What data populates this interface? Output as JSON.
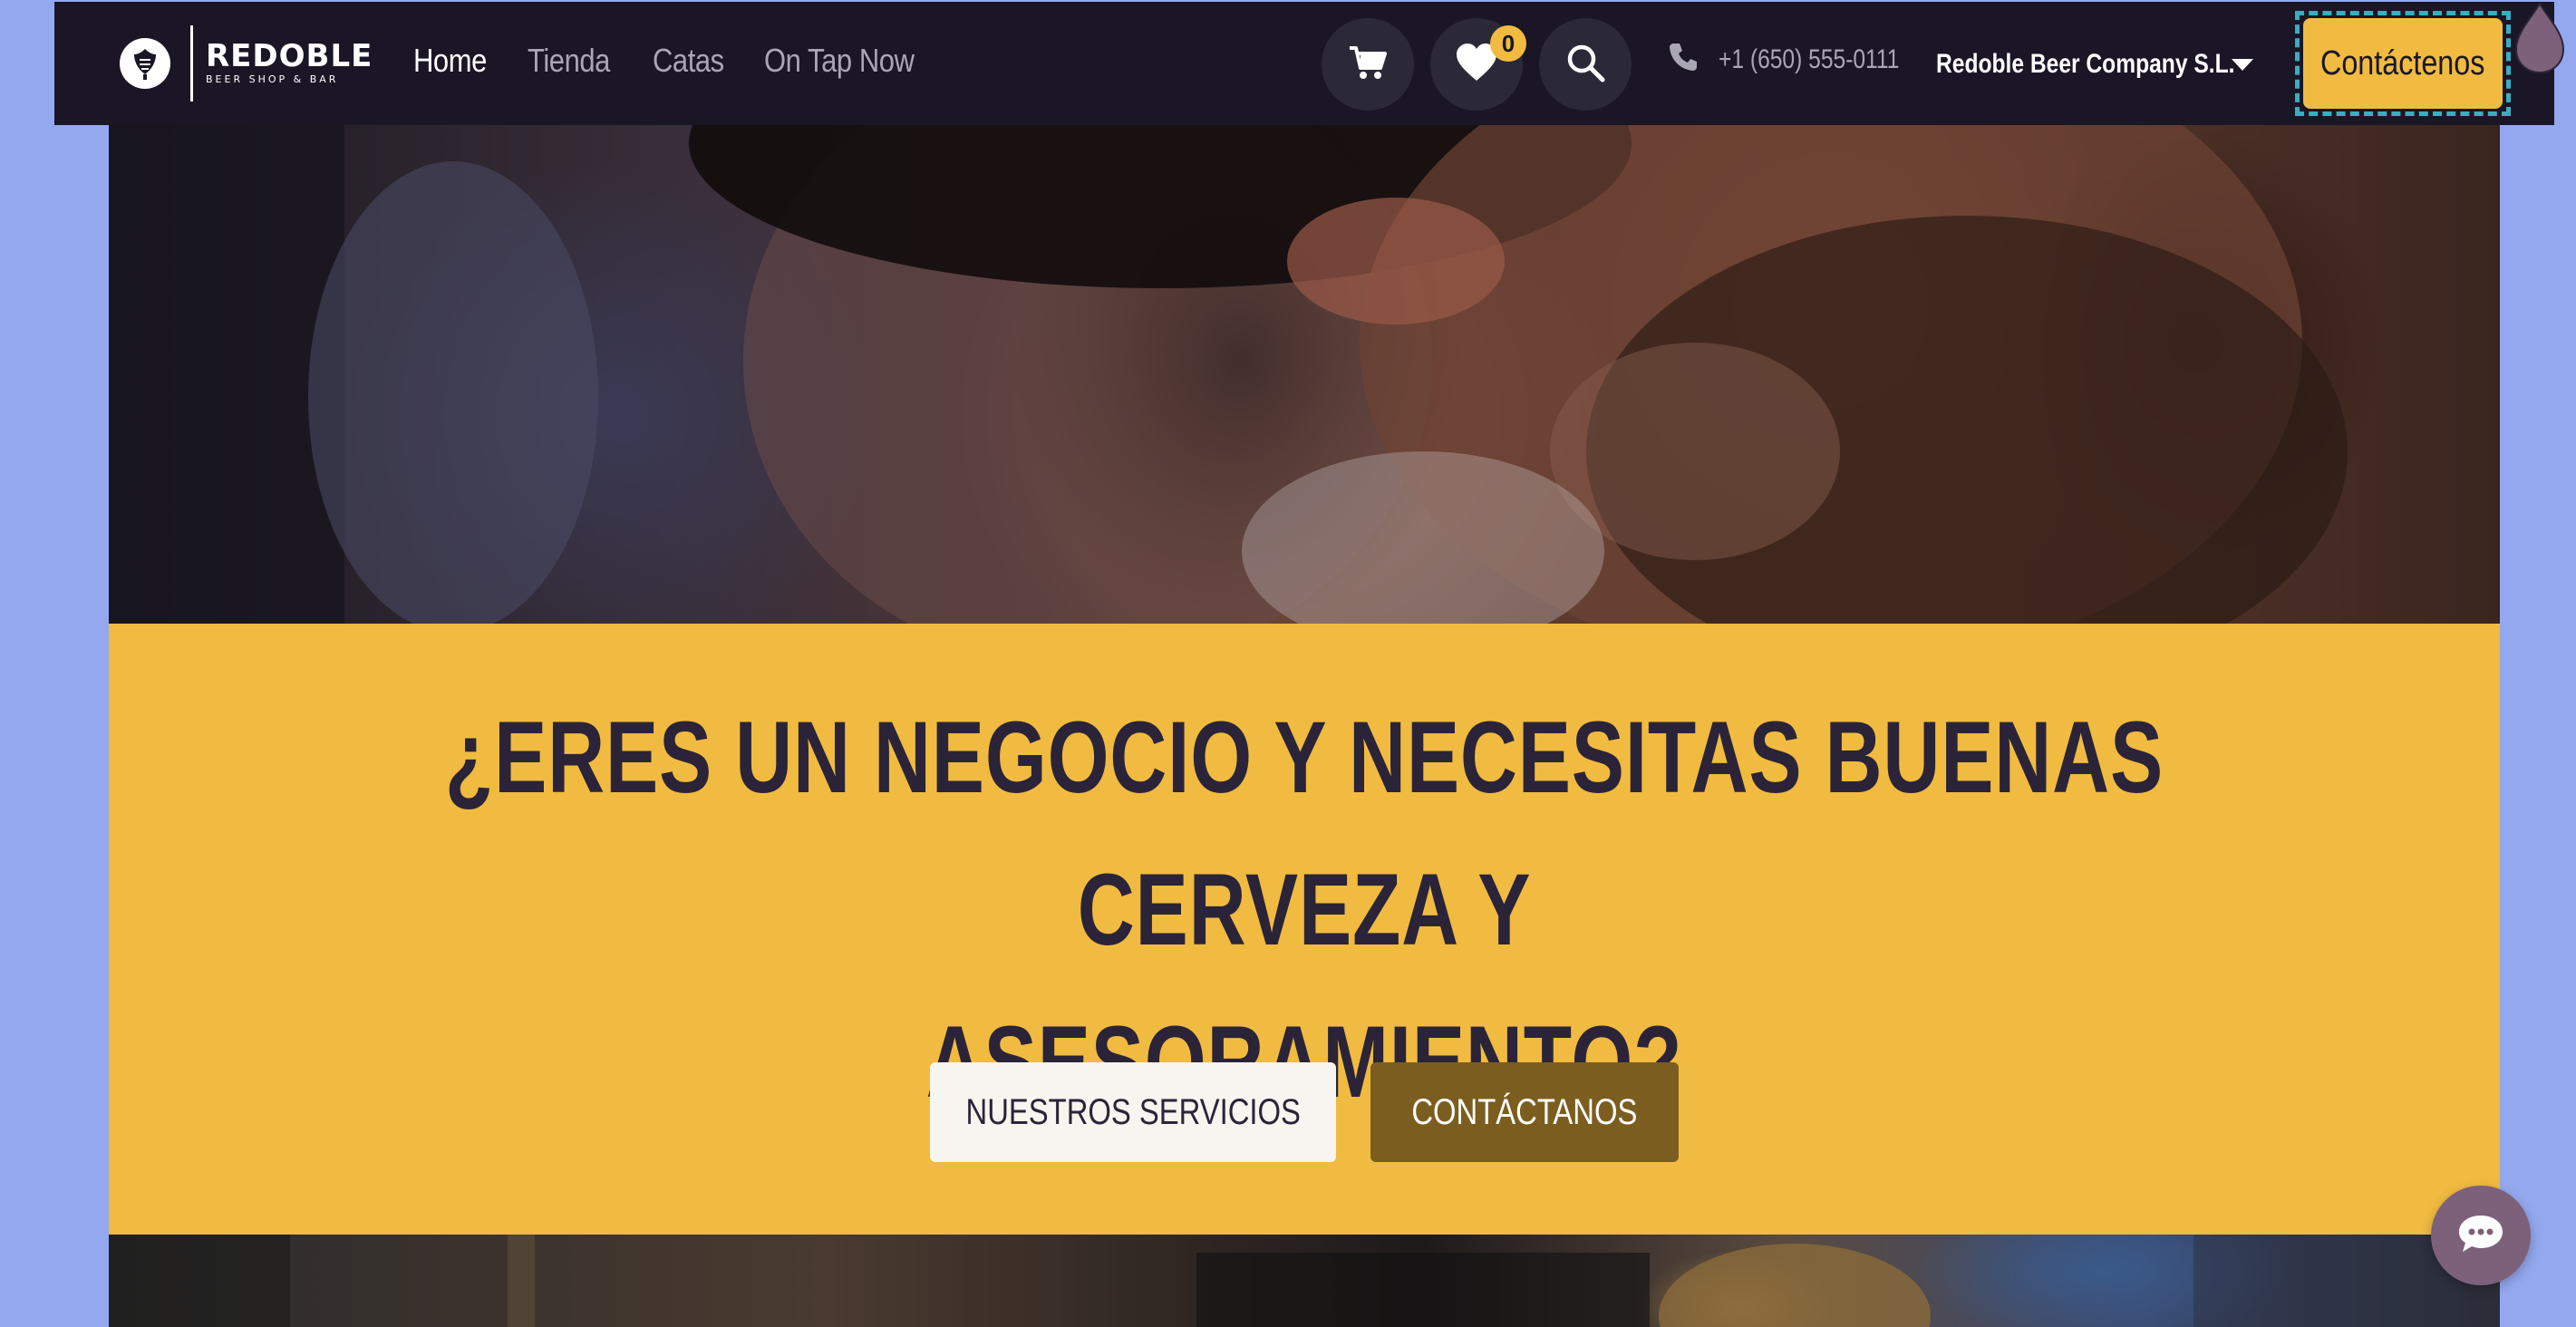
{
  "brand": {
    "name": "REDOBLE",
    "tagline": "BEER SHOP & BAR"
  },
  "nav": {
    "items": [
      {
        "label": "Home",
        "active": true
      },
      {
        "label": "Tienda",
        "active": false
      },
      {
        "label": "Catas",
        "active": false
      },
      {
        "label": "On Tap Now",
        "active": false
      }
    ]
  },
  "header": {
    "cart_icon": "cart-icon",
    "wishlist_icon": "heart-icon",
    "wishlist_count": "0",
    "search_icon": "search-icon",
    "phone_icon": "phone-icon",
    "phone": "+1 (650) 555-0111",
    "company": "Redoble Beer Company S.L.",
    "contact_button": "Contáctenos"
  },
  "cta": {
    "title_line1": "¿ERES UN NEGOCIO Y NECESITAS BUENAS CERVEZA Y",
    "title_line2": "ASESORAMIENTO?",
    "services_button": "NUESTROS SERVICIOS",
    "contact_button": "CONTÁCTANOS"
  },
  "chat": {
    "icon": "chat-icon"
  },
  "colors": {
    "page_bg": "#93a8ef",
    "navbar_bg": "#1a1626",
    "accent": "#f0bb40",
    "secondary_button": "#7b5e1f",
    "chat_button": "#7d607a"
  }
}
